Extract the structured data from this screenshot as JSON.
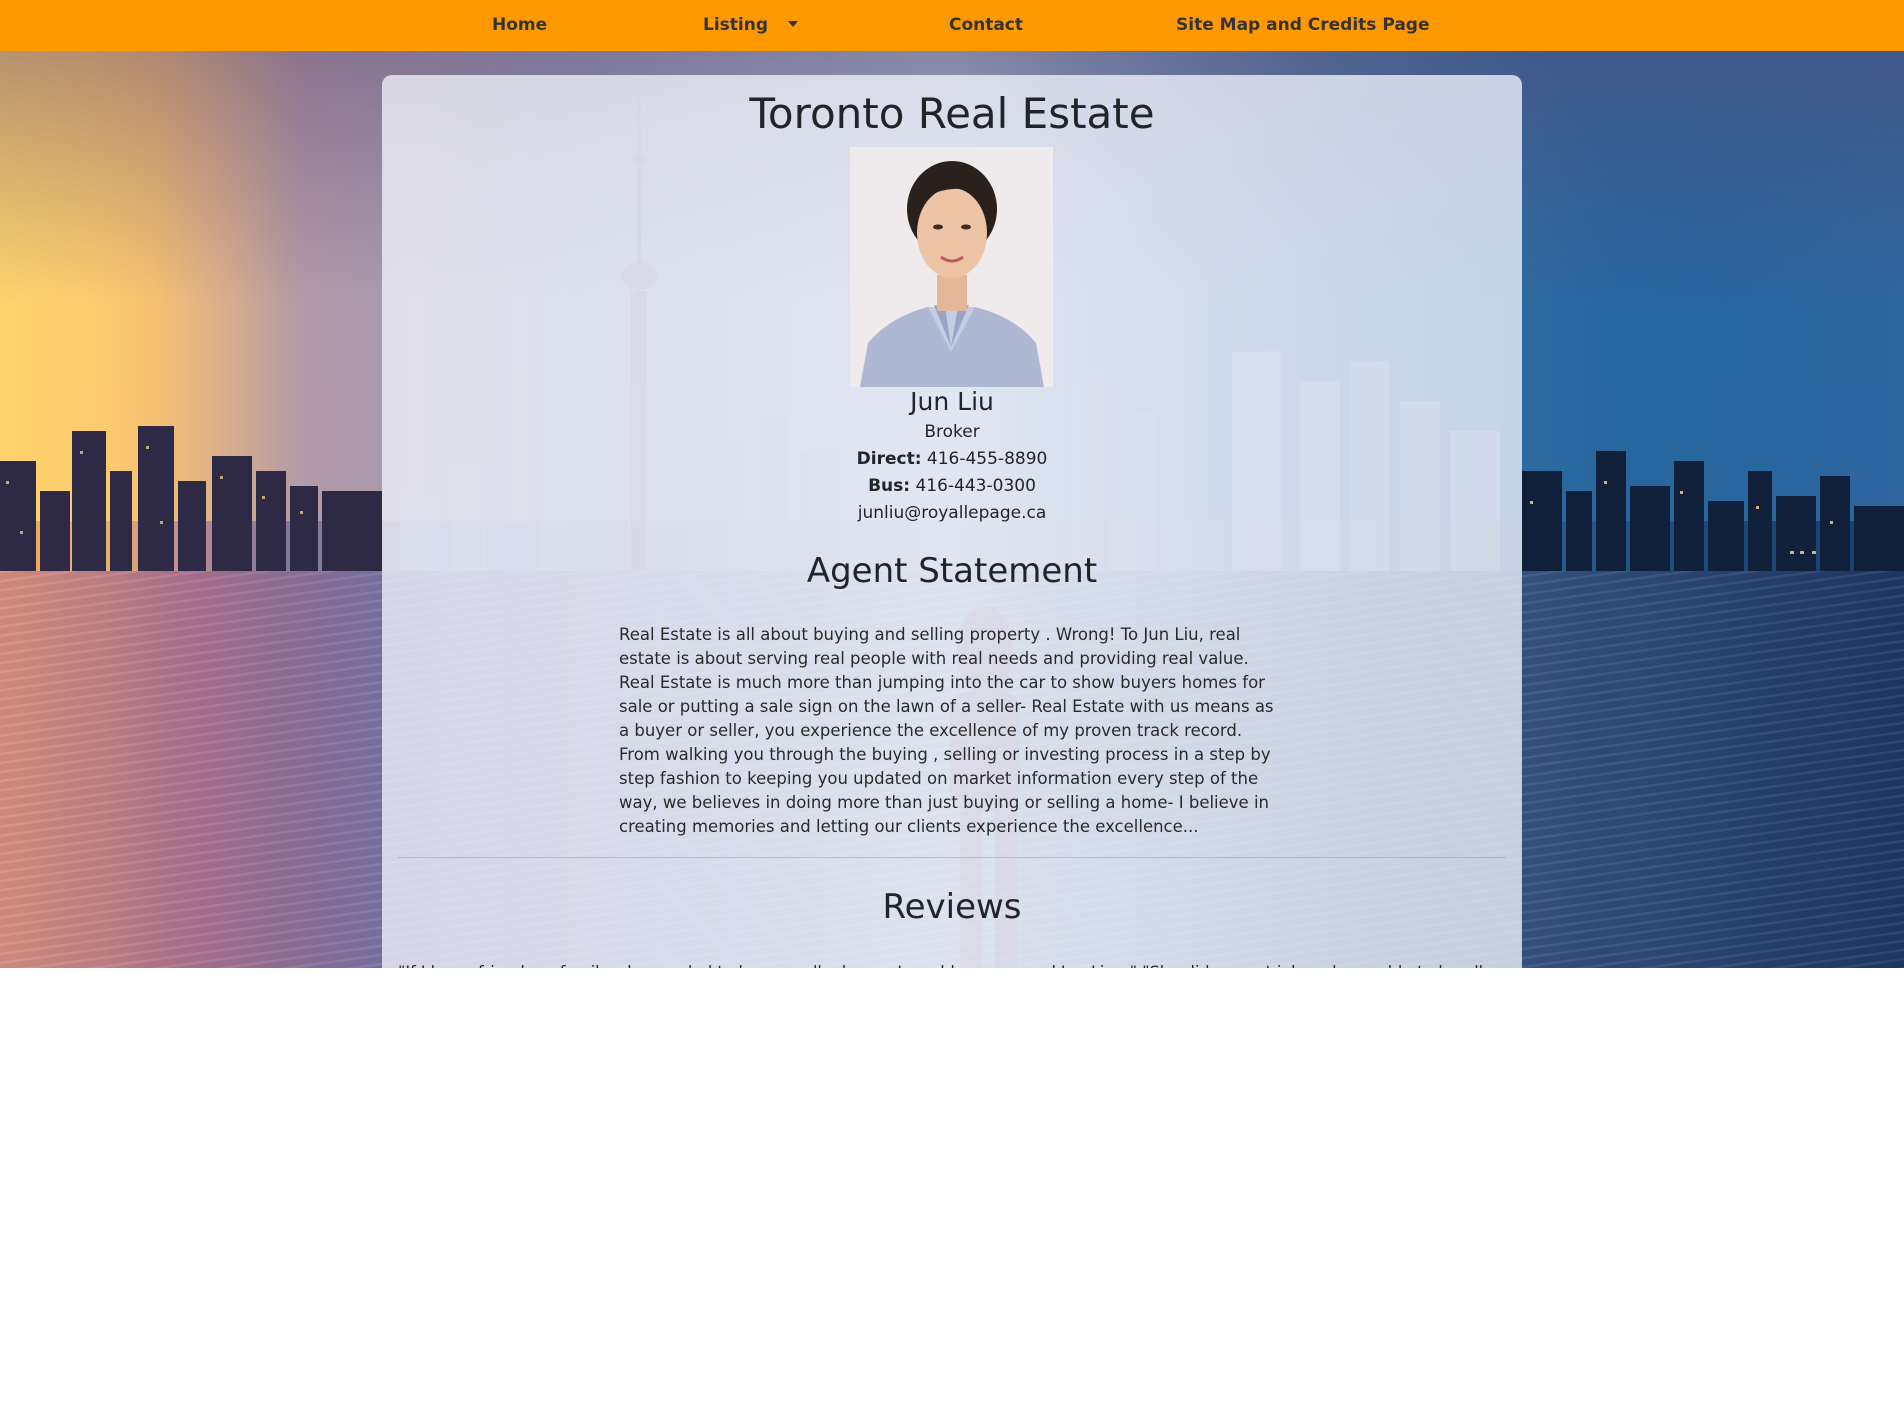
{
  "nav": {
    "home": "Home",
    "listing": "Listing",
    "contact": "Contact",
    "sitemap": "Site Map and Credits Page"
  },
  "colors": {
    "navbar": "#ff9900",
    "card": "rgba(240,242,250,0.78)"
  },
  "header": {
    "title": "Toronto Real Estate"
  },
  "agent": {
    "name": "Jun Liu",
    "role": "Broker",
    "direct_label": "Direct:",
    "direct_phone": "416-455-8890",
    "bus_label": "Bus:",
    "bus_phone": "416-443-0300",
    "email": "junliu@royallepage.ca"
  },
  "statement": {
    "title": "Agent Statement",
    "text": "Real Estate is all about buying and selling property . Wrong! To Jun Liu, real estate is about serving real people with real needs and providing real value. Real Estate is much more than jumping into the car to show buyers homes for sale or putting a sale sign on the lawn of a seller- Real Estate with us means as a buyer or seller, you experience the excellence of my proven track record. From walking you through the buying , selling or investing process in a step by step fashion to keeping you updated on market information every step of the way, we believes in doing more than just buying or selling a home- I believe in creating memories and letting our clients experience the excellence..."
  },
  "reviews": {
    "title": "Reviews",
    "snippet": "\"If I knew friends or family who needed to buy or sell a home, I would recommend Jun Liu...\" \"She did a great job and was able to handle everything\" \"Excellent\" the"
  }
}
